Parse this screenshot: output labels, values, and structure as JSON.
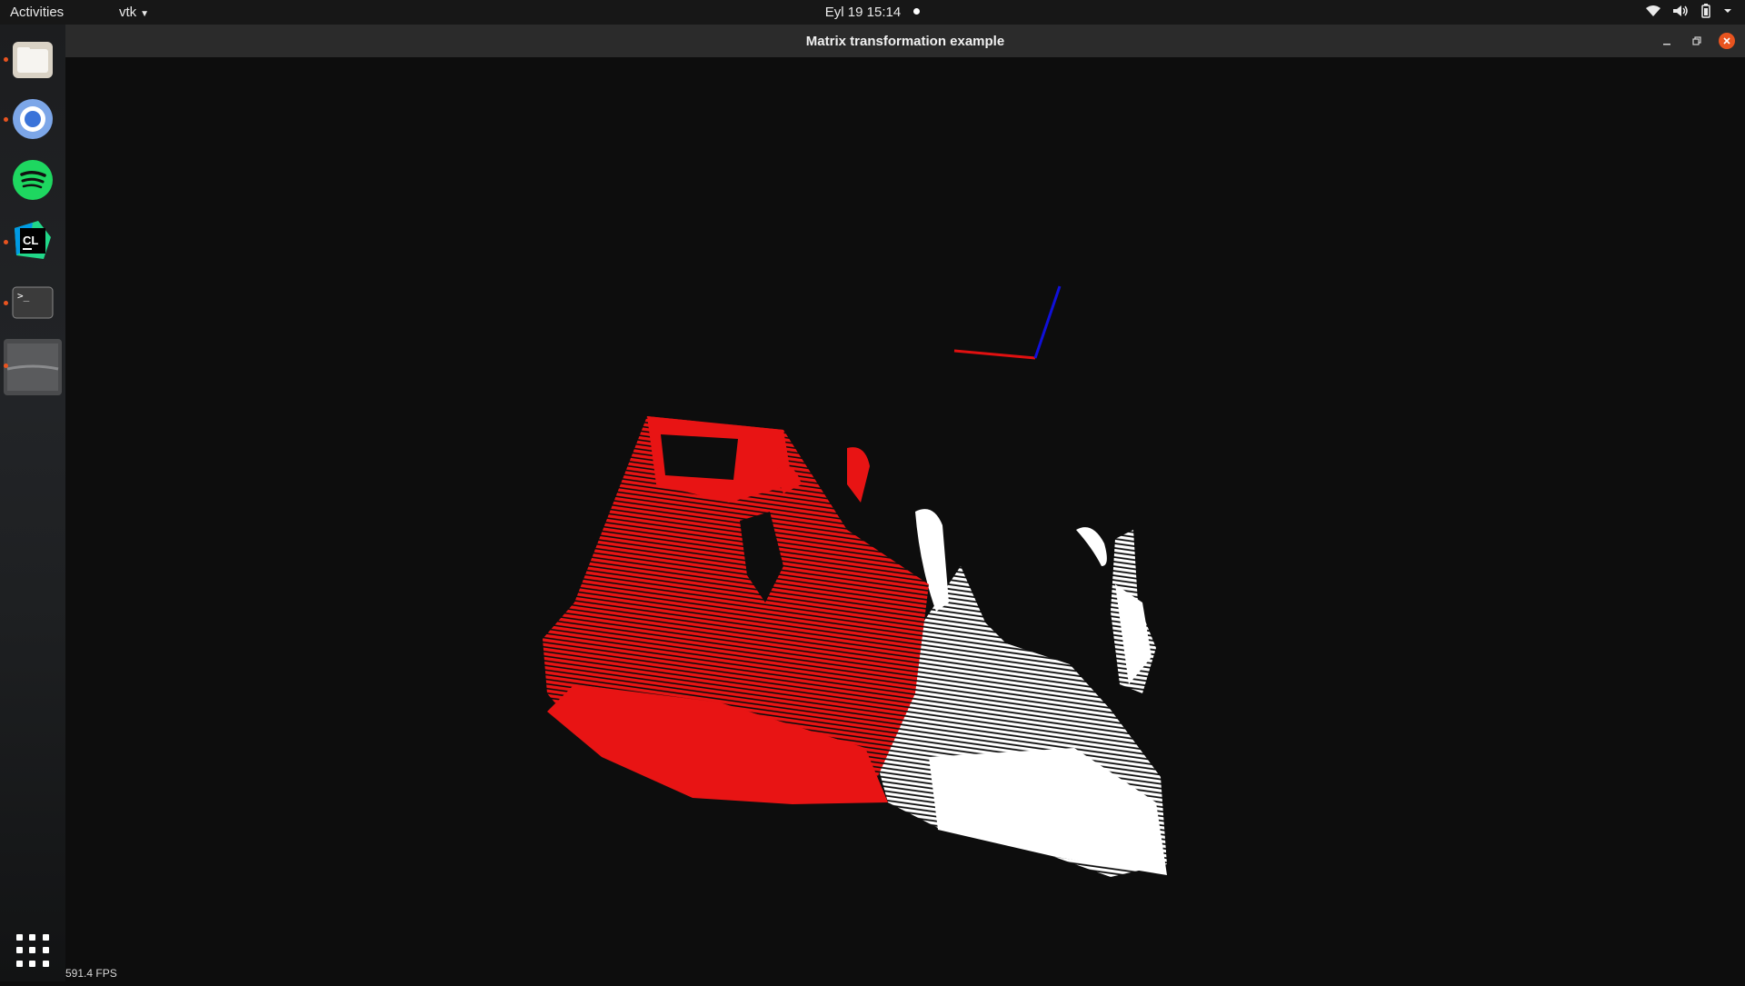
{
  "topbar": {
    "activities": "Activities",
    "app_menu": "vtk",
    "clock": "Eyl 19  15:14"
  },
  "dock": {
    "items": [
      {
        "name": "files",
        "icon": "folder-icon",
        "running": true
      },
      {
        "name": "chromium",
        "icon": "chromium-icon",
        "running": true
      },
      {
        "name": "spotify",
        "icon": "spotify-icon",
        "running": false
      },
      {
        "name": "clion",
        "icon": "clion-icon",
        "running": true
      },
      {
        "name": "terminal",
        "icon": "terminal-icon",
        "running": true
      },
      {
        "name": "vtk-window",
        "icon": "window-thumbnail-icon",
        "running": true
      }
    ]
  },
  "window": {
    "title": "Matrix transformation example"
  },
  "viewport": {
    "fps": "591.4 FPS",
    "axes_colors": {
      "x": "#e01010",
      "z": "#1010d8"
    },
    "point_cloud_colors": {
      "source": "#e81414",
      "target": "#ffffff"
    },
    "background": "#0d0d0d"
  }
}
